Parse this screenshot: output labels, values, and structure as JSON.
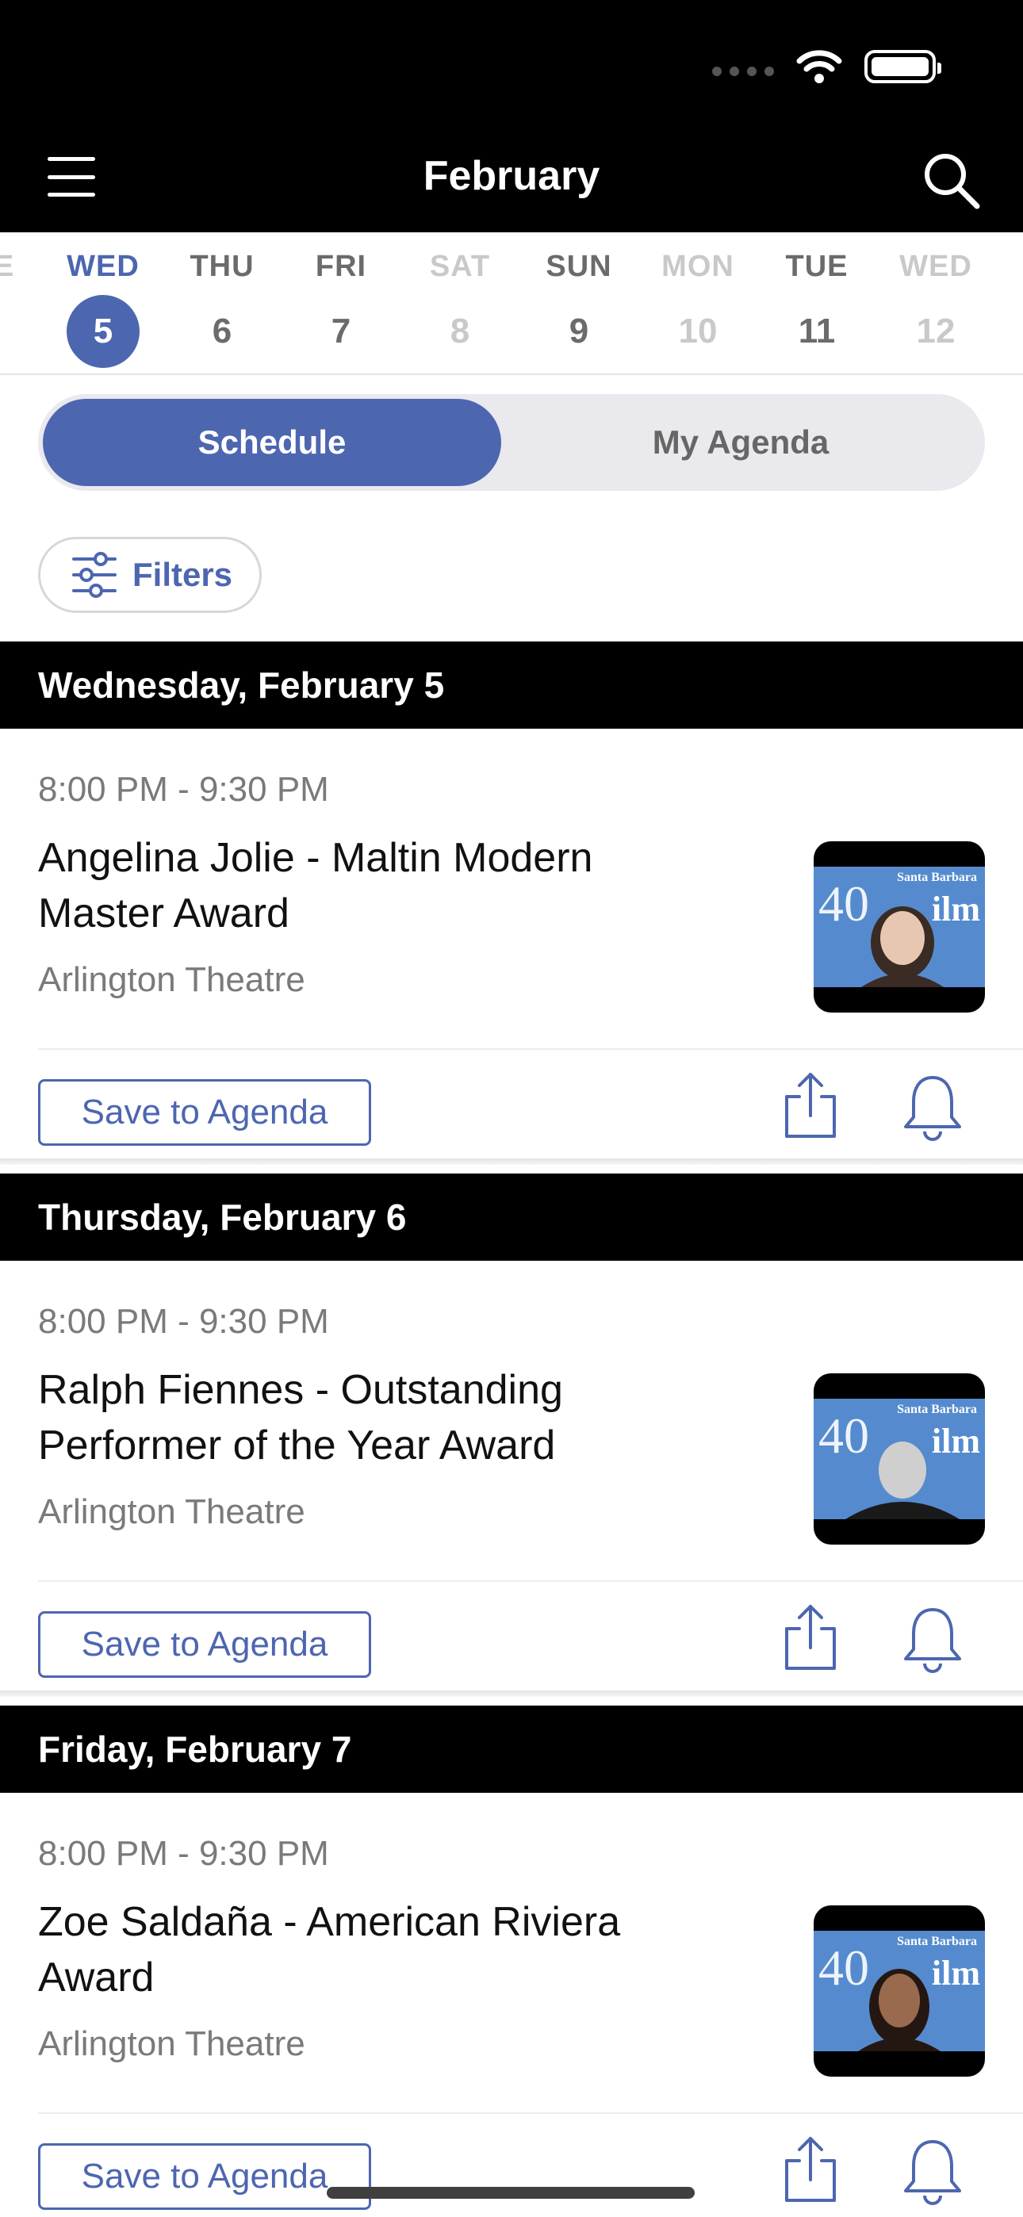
{
  "header": {
    "title": "February"
  },
  "date_strip": {
    "days": [
      {
        "dow": "E",
        "num": ""
      },
      {
        "dow": "WED",
        "num": "5",
        "state": "selected"
      },
      {
        "dow": "THU",
        "num": "6",
        "state": "normal"
      },
      {
        "dow": "FRI",
        "num": "7",
        "state": "normal"
      },
      {
        "dow": "SAT",
        "num": "8",
        "state": "faded"
      },
      {
        "dow": "SUN",
        "num": "9",
        "state": "normal"
      },
      {
        "dow": "MON",
        "num": "10",
        "state": "faded"
      },
      {
        "dow": "TUE",
        "num": "11",
        "state": "normal"
      },
      {
        "dow": "WED",
        "num": "12",
        "state": "faded"
      }
    ]
  },
  "tabs": {
    "schedule": "Schedule",
    "my_agenda": "My Agenda"
  },
  "filters": {
    "label": "Filters"
  },
  "sections": [
    {
      "header": "Wednesday, February 5",
      "event": {
        "time": "8:00 PM - 9:30 PM",
        "title": "Angelina Jolie - Maltin Modern Master Award",
        "venue": "Arlington Theatre",
        "save_label": "Save to Agenda"
      }
    },
    {
      "header": "Thursday, February 6",
      "event": {
        "time": "8:00 PM - 9:30 PM",
        "title": "Ralph Fiennes - Outstanding Performer of the Year Award",
        "venue": "Arlington Theatre",
        "save_label": "Save to Agenda"
      }
    },
    {
      "header": "Friday, February 7",
      "event": {
        "time": "8:00 PM - 9:30 PM",
        "title": "Zoe Saldaña - American Riviera Award",
        "venue": "Arlington Theatre",
        "save_label": "Save to Agenda"
      }
    }
  ],
  "colors": {
    "accent": "#4d66b0",
    "header_bg": "#000000",
    "muted_text": "#7a7a7a",
    "faded_text": "#c9c9c9"
  },
  "icons": [
    "menu-icon",
    "search-icon",
    "filters-icon",
    "share-icon",
    "bell-icon",
    "wifi-icon",
    "battery-icon"
  ]
}
